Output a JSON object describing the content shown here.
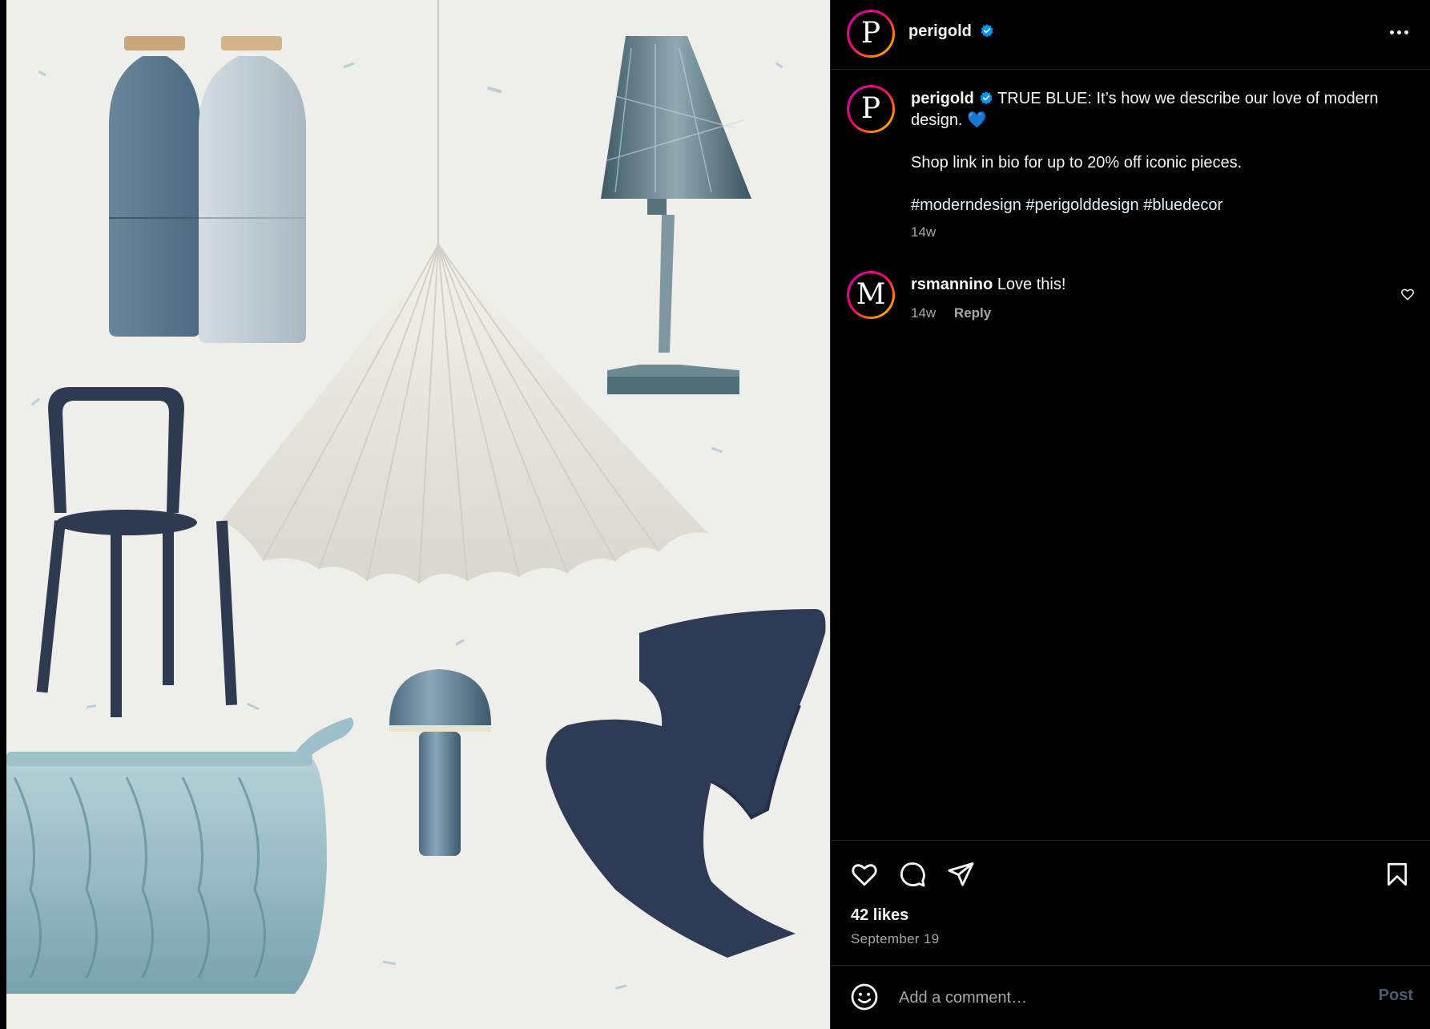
{
  "post": {
    "image_alt": "Collage of blue and white modern design pieces"
  },
  "header": {
    "avatar_letter": "P",
    "username": "perigold",
    "verified": true
  },
  "caption": {
    "avatar_letter": "P",
    "username": "perigold",
    "line1": "TRUE BLUE: It’s how we describe our love of modern design. 💙",
    "line2": "Shop link in bio for up to 20% off iconic pieces.",
    "hashtags": "#moderndesign #perigolddesign #bluedecor",
    "time": "14w"
  },
  "comments": [
    {
      "avatar_letter": "M",
      "username": "rsmannino",
      "text": "Love this!",
      "time": "14w",
      "reply_label": "Reply"
    }
  ],
  "actions": {
    "likes": "42 likes",
    "date": "September 19",
    "icons": [
      "heart-icon",
      "comment-icon",
      "share-icon",
      "bookmark-icon"
    ]
  },
  "comment_box": {
    "placeholder": "Add a comment…",
    "post_label": "Post"
  },
  "colors": {
    "background": "#000000",
    "text": "#f5f5f5",
    "muted": "#a8a8a8",
    "verified": "#0095f6",
    "post_disabled": "#4a5d73"
  }
}
